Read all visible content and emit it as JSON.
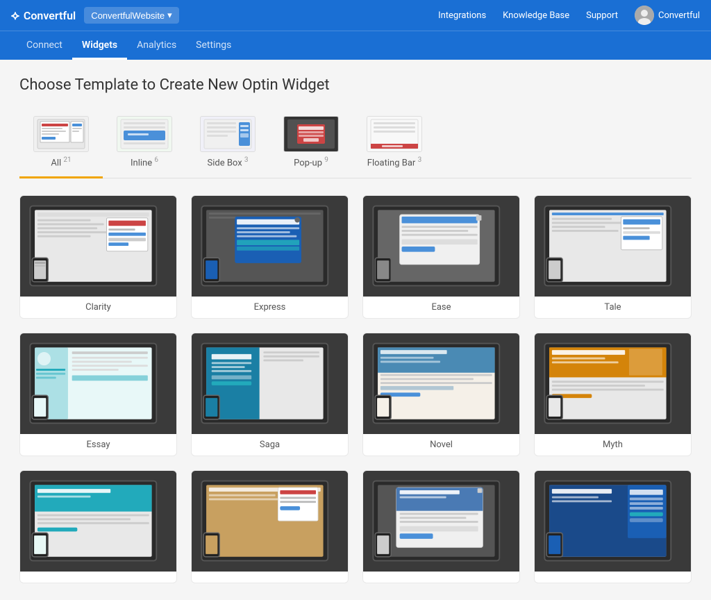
{
  "topnav": {
    "logo": "Convertful",
    "workspace": "ConvertfulWebsite",
    "links": [
      "Integrations",
      "Knowledge Base",
      "Support"
    ],
    "user": "Convertful"
  },
  "subnav": {
    "items": [
      "Connect",
      "Widgets",
      "Analytics",
      "Settings"
    ],
    "active": "Widgets"
  },
  "page": {
    "title": "Choose Template to Create New Optin Widget"
  },
  "filters": [
    {
      "label": "All",
      "count": "21",
      "active": true,
      "type": "all"
    },
    {
      "label": "Inline",
      "count": "6",
      "active": false,
      "type": "inline"
    },
    {
      "label": "Side Box",
      "count": "3",
      "active": false,
      "type": "sidebox"
    },
    {
      "label": "Pop-up",
      "count": "9",
      "active": false,
      "type": "popup"
    },
    {
      "label": "Floating Bar",
      "count": "3",
      "active": false,
      "type": "floatingbar"
    }
  ],
  "templates": [
    {
      "name": "Clarity",
      "type": "clarity"
    },
    {
      "name": "Express",
      "type": "express"
    },
    {
      "name": "Ease",
      "type": "ease"
    },
    {
      "name": "Tale",
      "type": "tale"
    },
    {
      "name": "Essay",
      "type": "essay"
    },
    {
      "name": "Saga",
      "type": "saga"
    },
    {
      "name": "Novel",
      "type": "novel"
    },
    {
      "name": "Myth",
      "type": "myth"
    },
    {
      "name": "",
      "type": "row3a"
    },
    {
      "name": "",
      "type": "row3b"
    },
    {
      "name": "",
      "type": "row3c"
    },
    {
      "name": "",
      "type": "row3d"
    }
  ]
}
